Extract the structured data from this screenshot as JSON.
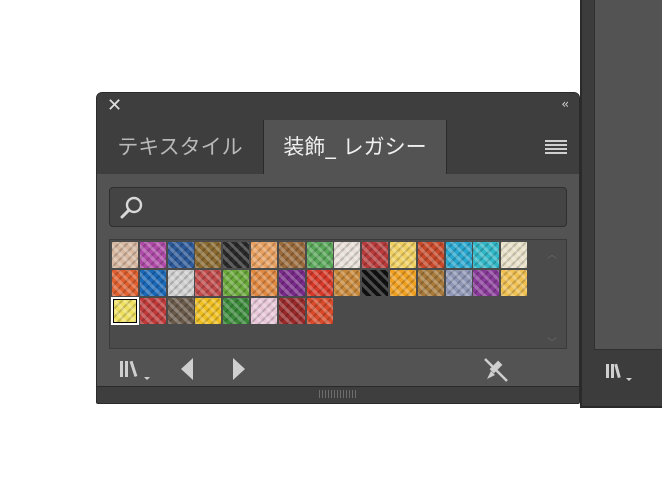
{
  "panel": {
    "tabs": [
      {
        "label": "テキスタイル",
        "active": false
      },
      {
        "label": "装飾_ レガシー",
        "active": true
      }
    ],
    "search": {
      "placeholder": "",
      "value": ""
    },
    "collapse_label": "‹‹",
    "close_label": "✕"
  },
  "swatches": {
    "rows": [
      [
        "#d8b8a0",
        "#b04aa8",
        "#2c5a9a",
        "#8a6a30",
        "#2a2a2a",
        "#e8a060",
        "#9a6a3a",
        "#5aa85a",
        "#e8e0d8",
        "#b83a3a",
        "#f0d060",
        "#c84a2a",
        "#28a8d0",
        "#30b8c8",
        "#e8e0c8"
      ],
      [
        "#e06030",
        "#1a68b8",
        "#d0d0d0",
        "#c04a4a",
        "#6aa83a",
        "#e08840",
        "#7a2a8a",
        "#d83a2a",
        "#c8883a",
        "#111111",
        "#f0a020",
        "#a87a3a",
        "#9098b8",
        "#8a3a9a",
        "#f0c050"
      ],
      [
        "#f0e060",
        "#c03a3a",
        "#6a5a4a",
        "#f0c020",
        "#3a8a3a",
        "#e8c8d8",
        "#9a2a2a",
        "#d84a2a"
      ]
    ],
    "selected": "2.0"
  },
  "bottombar": {
    "icons": [
      "library-icon",
      "previous-icon",
      "next-icon",
      "remove-brush-icon"
    ]
  },
  "colors": {
    "panel_bg": "#535353",
    "chrome_bg": "#3e3e3e",
    "text": "#f0f0f0",
    "muted_text": "#b8b8b8"
  }
}
